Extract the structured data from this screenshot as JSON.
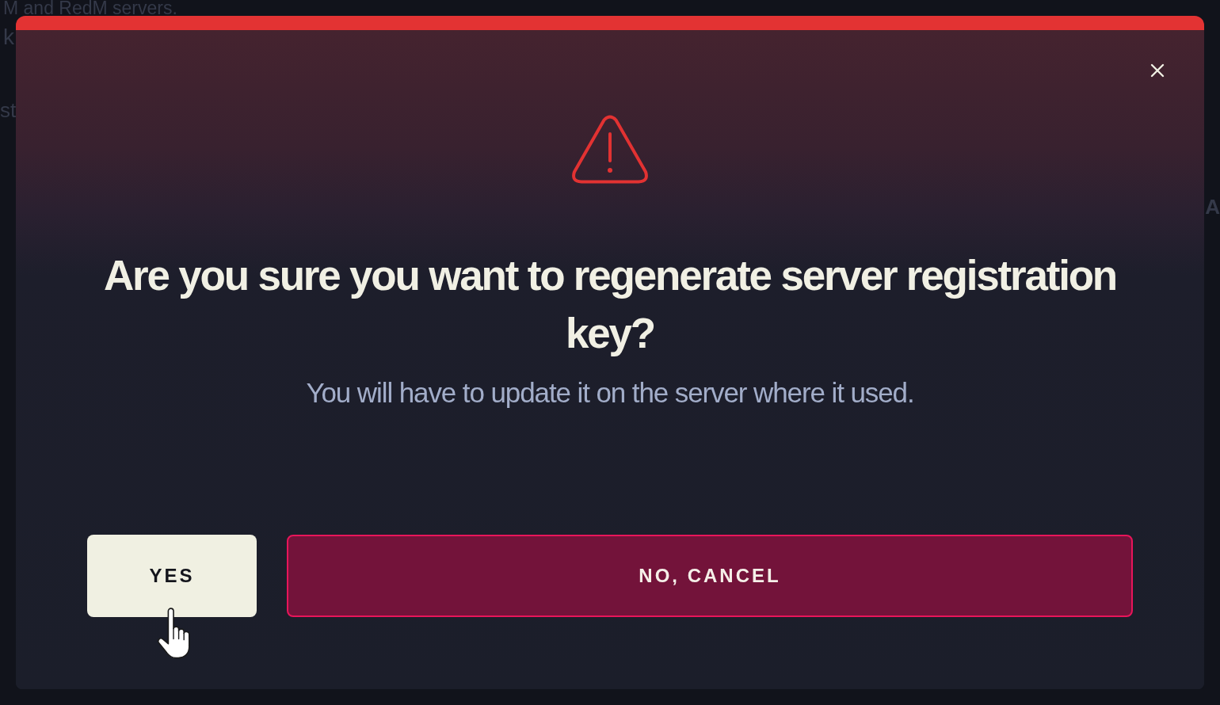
{
  "background_fragments": [
    "M and RedM servers.",
    "k",
    "st",
    "A"
  ],
  "dialog": {
    "title": "Are you sure you want to regenerate server registration key?",
    "message": "You will have to update it on the server where it used.",
    "buttons": [
      {
        "label": "YES",
        "kind": "primary"
      },
      {
        "label": "NO, CANCEL",
        "kind": "danger"
      }
    ]
  }
}
